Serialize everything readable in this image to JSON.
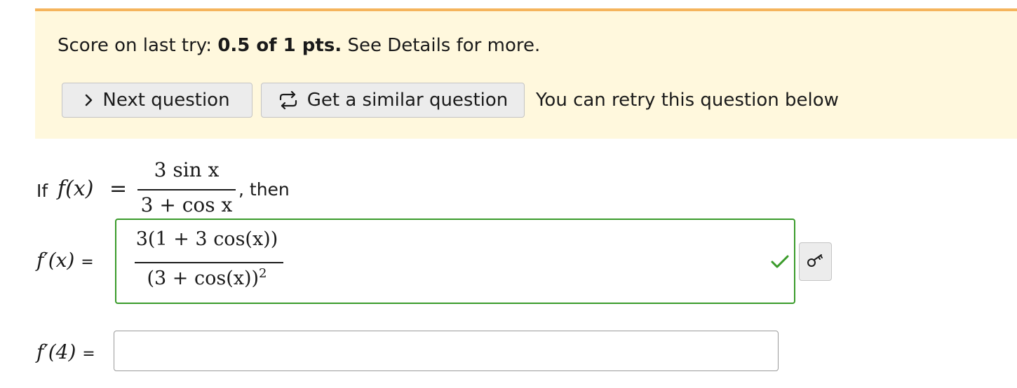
{
  "banner": {
    "score_prefix": "Score on last try:",
    "score_value": "0.5 of 1 pts.",
    "score_suffix": "See Details for more.",
    "next_button_label": "Next question",
    "similar_button_label": "Get a similar question",
    "retry_note": "You can retry this question below",
    "colors": {
      "background": "#fff8dd",
      "top_border": "#f5b45c"
    }
  },
  "question": {
    "if_label": "If",
    "function_lhs": "f(x)",
    "equals": "=",
    "numerator": "3 sin x",
    "denominator": "3 + cos x",
    "then_label": ", then"
  },
  "answer1": {
    "label": "f′(x)",
    "eq": "=",
    "numerator": "3(1 + 3 cos(x))",
    "denominator": "(3 + cos(x))",
    "denominator_exponent": "2",
    "status": "correct",
    "status_icon": "checkmark-icon",
    "preview_icon": "key-icon",
    "colors": {
      "correct_border": "#3a9b2a",
      "check": "#3a9b2a"
    }
  },
  "answer2": {
    "label": "f′(4)",
    "eq": "=",
    "value": "",
    "placeholder": ""
  }
}
